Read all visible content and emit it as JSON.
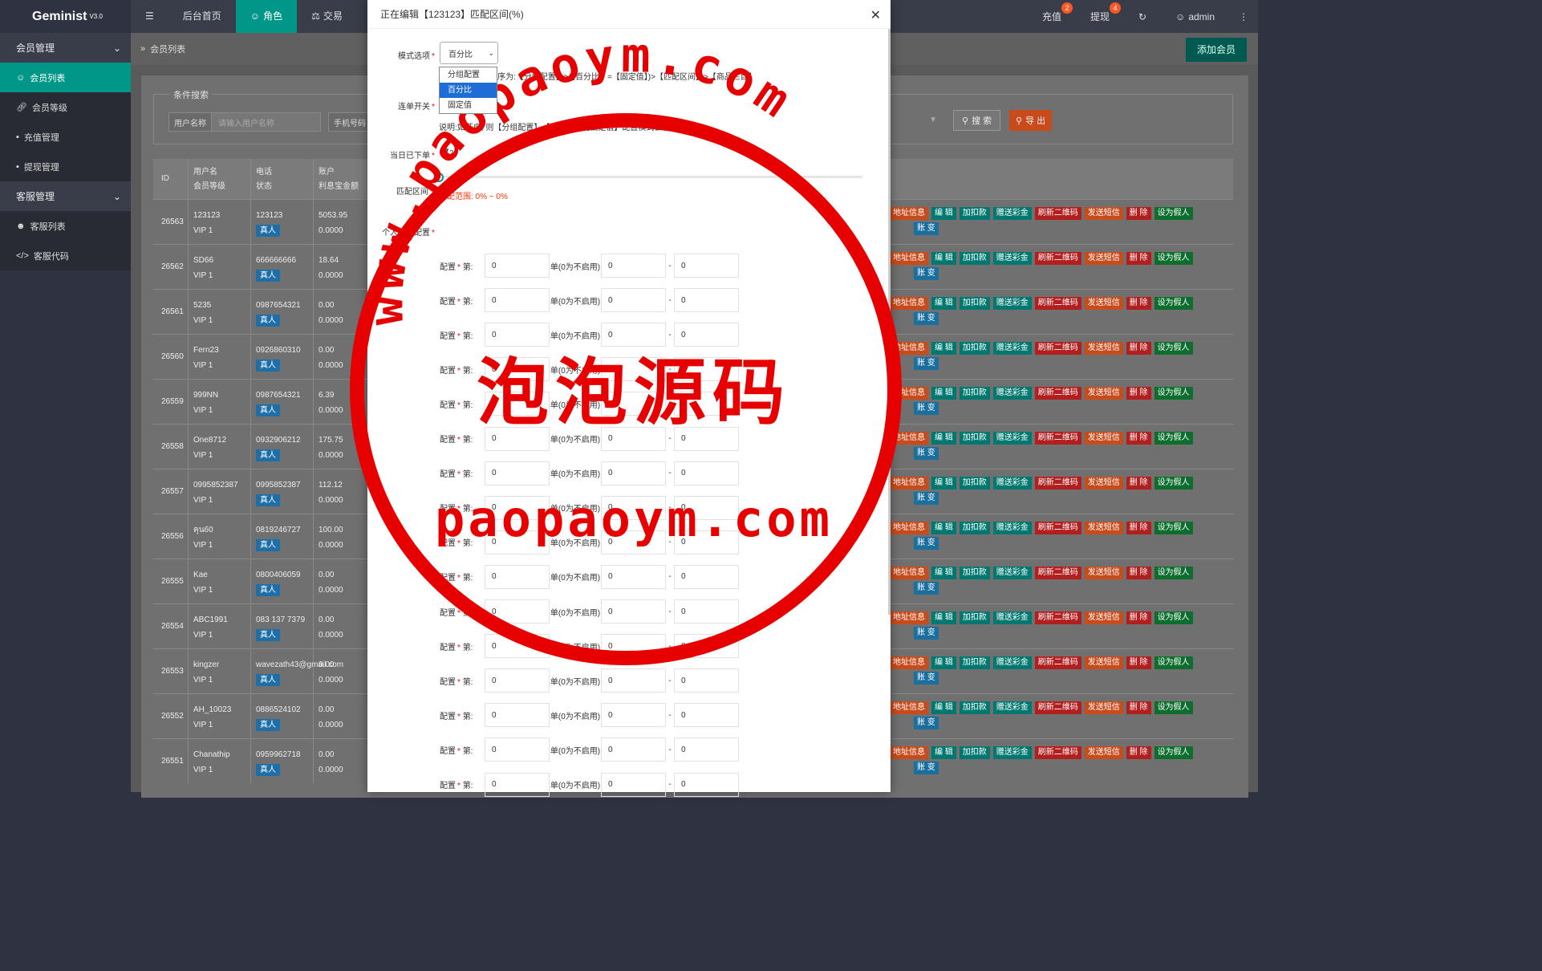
{
  "app": {
    "name": "Geminist",
    "version": "V3.0"
  },
  "topnav": [
    {
      "label": "",
      "icon": "menu-icon"
    },
    {
      "label": "后台首页"
    },
    {
      "label": "角色",
      "active": true
    },
    {
      "label": "交易"
    },
    {
      "label": ""
    }
  ],
  "topright": {
    "recharge": "充值",
    "recharge_badge": "2",
    "withdraw": "提现",
    "withdraw_badge": "4",
    "user": "admin"
  },
  "sidebar": [
    {
      "type": "group",
      "label": "会员管理"
    },
    {
      "type": "item",
      "label": "会员列表",
      "active": true
    },
    {
      "type": "item",
      "label": "会员等级"
    },
    {
      "type": "item",
      "label": "充值管理"
    },
    {
      "type": "item",
      "label": "提现管理"
    },
    {
      "type": "group",
      "label": "客服管理"
    },
    {
      "type": "item",
      "label": "客服列表"
    },
    {
      "type": "item",
      "label": "客服代码"
    }
  ],
  "breadcrumb": "会员列表",
  "add_member": "添加会员",
  "search": {
    "legend": "条件搜索",
    "username_label": "用户名称",
    "username_placeholder": "请输入用户名称",
    "phone_label": "手机号码",
    "search_btn": "搜 索",
    "export_btn": "导 出"
  },
  "table": {
    "headers": {
      "id": "ID",
      "user1": "用户名",
      "user2": "会员等级",
      "phone1": "电话",
      "phone2": "状态",
      "acct1": "账户",
      "acct2": "利息宝金额"
    },
    "rows": [
      {
        "id": "26563",
        "user": "123123",
        "level": "VIP 1",
        "phone": "123123",
        "tag": "真人",
        "balance": "5053.95",
        "interest": "0.0000"
      },
      {
        "id": "26562",
        "user": "SD66",
        "level": "VIP 1",
        "phone": "666666666",
        "tag": "真人",
        "balance": "18.64",
        "interest": "0.0000"
      },
      {
        "id": "26561",
        "user": "5235",
        "level": "VIP 1",
        "phone": "0987654321",
        "tag": "真人",
        "balance": "0.00",
        "interest": "0.0000"
      },
      {
        "id": "26560",
        "user": "Fern23",
        "level": "VIP 1",
        "phone": "0926860310",
        "tag": "真人",
        "balance": "0.00",
        "interest": "0.0000"
      },
      {
        "id": "26559",
        "user": "999NN",
        "level": "VIP 1",
        "phone": "0987654321",
        "tag": "真人",
        "balance": "6.39",
        "interest": "0.0000"
      },
      {
        "id": "26558",
        "user": "One8712",
        "level": "VIP 1",
        "phone": "0932906212",
        "tag": "真人",
        "balance": "175.75",
        "interest": "0.0000"
      },
      {
        "id": "26557",
        "user": "0995852387",
        "level": "VIP 1",
        "phone": "0995852387",
        "tag": "真人",
        "balance": "112.12",
        "interest": "0.0000"
      },
      {
        "id": "26556",
        "user": "คุน60",
        "level": "VIP 1",
        "phone": "0819246727",
        "tag": "真人",
        "balance": "100.00",
        "interest": "0.0000"
      },
      {
        "id": "26555",
        "user": "Kae",
        "level": "VIP 1",
        "phone": "0800406059",
        "tag": "真人",
        "balance": "0.00",
        "interest": "0.0000"
      },
      {
        "id": "26554",
        "user": "ABC1991",
        "level": "VIP 1",
        "phone": "083 137 7379",
        "tag": "真人",
        "balance": "0.00",
        "interest": "0.0000"
      },
      {
        "id": "26553",
        "user": "kingzer",
        "level": "VIP 1",
        "phone": "wavezath43@gmail.com",
        "tag": "真人",
        "balance": "0.00",
        "interest": "0.0000"
      },
      {
        "id": "26552",
        "user": "AH_10023",
        "level": "VIP 1",
        "phone": "0886524102",
        "tag": "真人",
        "balance": "0.00",
        "interest": "0.0000"
      },
      {
        "id": "26551",
        "user": "Chanathip",
        "level": "VIP 1",
        "phone": "0959962718",
        "tag": "真人",
        "balance": "0.00",
        "interest": "0.0000"
      }
    ],
    "ops": {
      "addr": "地址信息",
      "edit": "编 辑",
      "adjust": "加扣款",
      "gift": "赠送彩金",
      "qr": "刷新二维码",
      "sms": "发送短信",
      "delete": "删 除",
      "fake": "设为假人",
      "ledger": "账 变"
    }
  },
  "modal": {
    "title": "正在编辑【123123】匹配区间(%)",
    "mode_label": "模式选项",
    "mode_value": "百分比",
    "mode_options": [
      "分组配置",
      "百分比",
      "固定值"
    ],
    "priority_text": "序为:【分组配置】>(【百分比】=【固定值】)>【匹配区间】>【商品栏目】",
    "combo_label": "连单开关",
    "combo_desc": "说明:如开启, 则【分组配置】、【百分比】、【固定值】配置模式会自动抢单。",
    "today_label": "当日已下单",
    "today_value": "【2】",
    "range_label": "匹配区间",
    "range_text": "匹配范围: 0% ~ 0%",
    "personal_label": "个人订单配置",
    "cfg_label": "配置",
    "cfg_order": "第:",
    "cfg_disabled": "单(0为不启用)",
    "cfg_dash": "-",
    "cfg_rows": [
      [
        "0",
        "0",
        "0"
      ],
      [
        "0",
        "0",
        "0"
      ],
      [
        "0",
        "0",
        "0"
      ],
      [
        "0",
        "0",
        "0"
      ],
      [
        "0",
        "0",
        "0"
      ],
      [
        "0",
        "0",
        "0"
      ],
      [
        "0",
        "0",
        "0"
      ],
      [
        "0",
        "0",
        "0"
      ],
      [
        "0",
        "0",
        "0"
      ],
      [
        "0",
        "0",
        "0"
      ],
      [
        "0",
        "0",
        "0"
      ],
      [
        "0",
        "0",
        "0"
      ],
      [
        "0",
        "0",
        "0"
      ],
      [
        "0",
        "0",
        "0"
      ],
      [
        "0",
        "0",
        "0"
      ],
      [
        "0",
        "0",
        "0"
      ]
    ]
  },
  "watermark": {
    "arc_text": "www.paopaoym.com",
    "center_cn": "泡泡源码",
    "bottom_url": "paopaoym.com",
    "color": "#e60000"
  }
}
